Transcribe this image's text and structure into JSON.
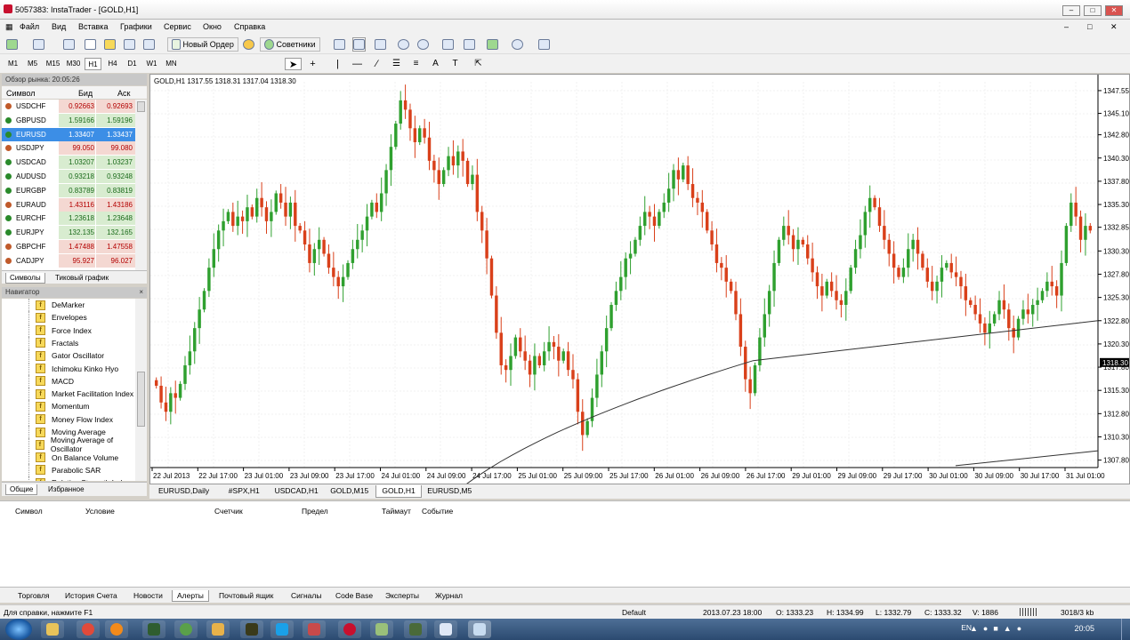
{
  "window": {
    "title": "5057383: InstaTrader - [GOLD,H1]"
  },
  "menu": [
    "Файл",
    "Вид",
    "Вставка",
    "Графики",
    "Сервис",
    "Окно",
    "Справка"
  ],
  "toolbar": {
    "new_order": "Новый Ордер",
    "advisors": "Советники"
  },
  "timeframes": [
    "M1",
    "M5",
    "M15",
    "M30",
    "H1",
    "H4",
    "D1",
    "W1",
    "MN"
  ],
  "active_timeframe": "H1",
  "market_watch": {
    "header": "Обзор рынка: 20:05:26",
    "col_symbol": "Символ",
    "col_bid": "Бид",
    "col_ask": "Аск",
    "rows": [
      {
        "symbol": "USDCHF",
        "bid": "0.92663",
        "ask": "0.92693",
        "dir": "down"
      },
      {
        "symbol": "GBPUSD",
        "bid": "1.59166",
        "ask": "1.59196",
        "dir": "up"
      },
      {
        "symbol": "EURUSD",
        "bid": "1.33407",
        "ask": "1.33437",
        "dir": "up",
        "selected": true
      },
      {
        "symbol": "USDJPY",
        "bid": "99.050",
        "ask": "99.080",
        "dir": "down"
      },
      {
        "symbol": "USDCAD",
        "bid": "1.03207",
        "ask": "1.03237",
        "dir": "up"
      },
      {
        "symbol": "AUDUSD",
        "bid": "0.93218",
        "ask": "0.93248",
        "dir": "up"
      },
      {
        "symbol": "EURGBP",
        "bid": "0.83789",
        "ask": "0.83819",
        "dir": "up"
      },
      {
        "symbol": "EURAUD",
        "bid": "1.43116",
        "ask": "1.43186",
        "dir": "down"
      },
      {
        "symbol": "EURCHF",
        "bid": "1.23618",
        "ask": "1.23648",
        "dir": "up"
      },
      {
        "symbol": "EURJPY",
        "bid": "132.135",
        "ask": "132.165",
        "dir": "up"
      },
      {
        "symbol": "GBPCHF",
        "bid": "1.47488",
        "ask": "1.47558",
        "dir": "down"
      },
      {
        "symbol": "CADJPY",
        "bid": "95.927",
        "ask": "96.027",
        "dir": "down"
      }
    ],
    "tabs": [
      "Символы",
      "Тиковый график"
    ]
  },
  "navigator": {
    "header": "Навигатор",
    "items": [
      "DeMarker",
      "Envelopes",
      "Force Index",
      "Fractals",
      "Gator Oscillator",
      "Ichimoku Kinko Hyo",
      "MACD",
      "Market Facilitation Index",
      "Momentum",
      "Money Flow Index",
      "Moving Average",
      "Moving Average of Oscillator",
      "On Balance Volume",
      "Parabolic SAR",
      "Relative Strength Index"
    ],
    "tabs": [
      "Общие",
      "Избранное"
    ]
  },
  "chart": {
    "info": "GOLD,H1  1317.55 1318.31 1317.04 1318.30",
    "current_price": "1318.30",
    "y_labels": [
      "1347.55",
      "1345.10",
      "1342.80",
      "1340.30",
      "1337.80",
      "1335.30",
      "1332.85",
      "1330.30",
      "1327.80",
      "1325.30",
      "1322.80",
      "1320.30",
      "1317.80",
      "1315.30",
      "1312.80",
      "1310.30",
      "1307.80"
    ],
    "x_labels": [
      "22 Jul 2013",
      "22 Jul 17:00",
      "23 Jul 01:00",
      "23 Jul 09:00",
      "23 Jul 17:00",
      "24 Jul 01:00",
      "24 Jul 09:00",
      "24 Jul 17:00",
      "25 Jul 01:00",
      "25 Jul 09:00",
      "25 Jul 17:00",
      "26 Jul 01:00",
      "26 Jul 09:00",
      "26 Jul 17:00",
      "29 Jul 01:00",
      "29 Jul 09:00",
      "29 Jul 17:00",
      "30 Jul 01:00",
      "30 Jul 09:00",
      "30 Jul 17:00",
      "31 Jul 01:00"
    ],
    "tabs": [
      "EURUSD,Daily",
      "#SPX,H1",
      "USDCAD,H1",
      "GOLD,M15",
      "GOLD,H1",
      "EURUSD,M5"
    ],
    "active_tab": "GOLD,H1",
    "up_color": "#2fa02f",
    "down_color": "#d9401a"
  },
  "chart_data": {
    "type": "candlestick",
    "ylim": [
      1307.0,
      1348.5
    ],
    "close": [
      1315.8,
      1314.0,
      1313.0,
      1315.0,
      1314.5,
      1316.0,
      1318.0,
      1319.5,
      1322.0,
      1324.0,
      1326.0,
      1328.5,
      1330.5,
      1332.5,
      1333.5,
      1334.5,
      1333.0,
      1334.0,
      1333.5,
      1335.0,
      1334.0,
      1336.0,
      1335.0,
      1333.5,
      1334.5,
      1336.5,
      1335.5,
      1334.0,
      1335.5,
      1333.0,
      1332.5,
      1331.0,
      1329.0,
      1330.5,
      1331.5,
      1330.0,
      1328.5,
      1327.5,
      1326.5,
      1327.5,
      1329.0,
      1330.5,
      1331.5,
      1332.5,
      1334.0,
      1335.5,
      1334.5,
      1336.5,
      1339.0,
      1341.5,
      1344.0,
      1346.5,
      1345.5,
      1343.5,
      1342.0,
      1343.5,
      1342.5,
      1340.0,
      1339.0,
      1337.5,
      1339.0,
      1340.5,
      1339.5,
      1341.0,
      1340.0,
      1337.5,
      1338.5,
      1334.5,
      1332.5,
      1329.5,
      1325.5,
      1321.5,
      1318.0,
      1317.5,
      1319.0,
      1321.0,
      1319.5,
      1318.5,
      1317.0,
      1319.0,
      1318.0,
      1319.5,
      1320.5,
      1320.0,
      1318.5,
      1319.5,
      1317.5,
      1316.5,
      1313.0,
      1310.5,
      1312.0,
      1314.5,
      1317.0,
      1319.5,
      1322.0,
      1324.5,
      1326.0,
      1327.5,
      1329.5,
      1330.0,
      1331.5,
      1333.0,
      1334.5,
      1334.0,
      1333.0,
      1334.5,
      1335.5,
      1337.0,
      1339.0,
      1338.0,
      1339.5,
      1337.5,
      1336.0,
      1335.5,
      1334.5,
      1332.5,
      1331.0,
      1329.0,
      1328.5,
      1327.0,
      1326.0,
      1323.5,
      1320.0,
      1316.5,
      1315.0,
      1318.0,
      1321.0,
      1323.5,
      1326.0,
      1329.0,
      1331.5,
      1333.0,
      1332.0,
      1330.5,
      1331.5,
      1331.0,
      1329.5,
      1328.0,
      1326.5,
      1325.5,
      1327.0,
      1326.0,
      1325.0,
      1324.5,
      1326.0,
      1328.5,
      1330.5,
      1332.0,
      1334.5,
      1336.0,
      1335.0,
      1333.0,
      1331.5,
      1330.0,
      1328.5,
      1327.5,
      1328.5,
      1330.5,
      1331.5,
      1330.0,
      1328.5,
      1327.0,
      1326.0,
      1327.0,
      1328.5,
      1329.0,
      1328.0,
      1327.5,
      1326.5,
      1325.0,
      1324.5,
      1323.5,
      1322.5,
      1321.5,
      1322.5,
      1323.5,
      1325.0,
      1324.0,
      1322.0,
      1321.0,
      1323.0,
      1324.0,
      1323.5,
      1324.5,
      1325.0,
      1326.0,
      1327.0,
      1326.5,
      1325.5,
      1329.0,
      1333.0,
      1335.5,
      1334.0,
      1331.5,
      1333.0,
      1332.5
    ],
    "ma": [
      1296.0,
      1318.5,
      1322.8
    ]
  }
}
